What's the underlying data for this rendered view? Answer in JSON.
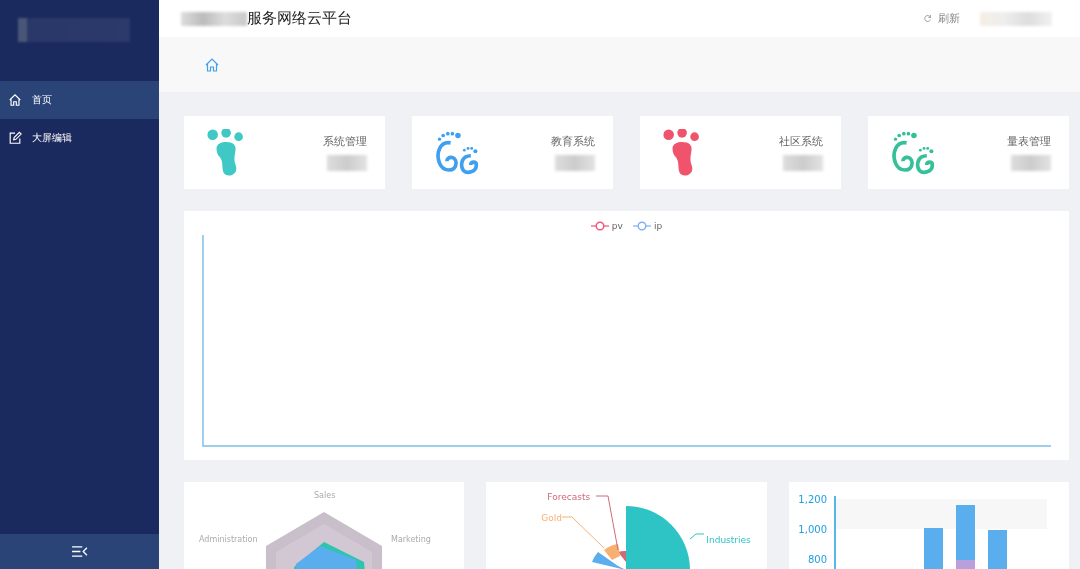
{
  "sidebar": {
    "items": [
      {
        "label": "首页",
        "selected": true
      },
      {
        "label": "大屏编辑",
        "selected": false
      }
    ]
  },
  "header": {
    "title": "服务网络云平台",
    "refresh": "刷新"
  },
  "stats": [
    {
      "label": "系统管理",
      "kind": "foot",
      "color": "#3fc8c4"
    },
    {
      "label": "教育系统",
      "kind": "feet",
      "color": "#3fa0f0"
    },
    {
      "label": "社区系统",
      "kind": "foot",
      "color": "#f0546c"
    },
    {
      "label": "量表管理",
      "kind": "feet",
      "color": "#35c09a"
    }
  ],
  "line_chart": {
    "legend": [
      {
        "name": "pv",
        "color": "#f0547c"
      },
      {
        "name": "ip",
        "color": "#80aef0"
      }
    ]
  },
  "radar": {
    "labels": [
      "Sales",
      "Administration",
      "Marketing"
    ]
  },
  "rose": {
    "labels": [
      {
        "text": "Forecasts",
        "color": "#d06a78"
      },
      {
        "text": "Gold",
        "color": "#f8b070"
      },
      {
        "text": "Industries",
        "color": "#2ec4c6"
      }
    ]
  },
  "bar_chart": {
    "y_labels": [
      "1,200",
      "1,000",
      "800"
    ]
  }
}
